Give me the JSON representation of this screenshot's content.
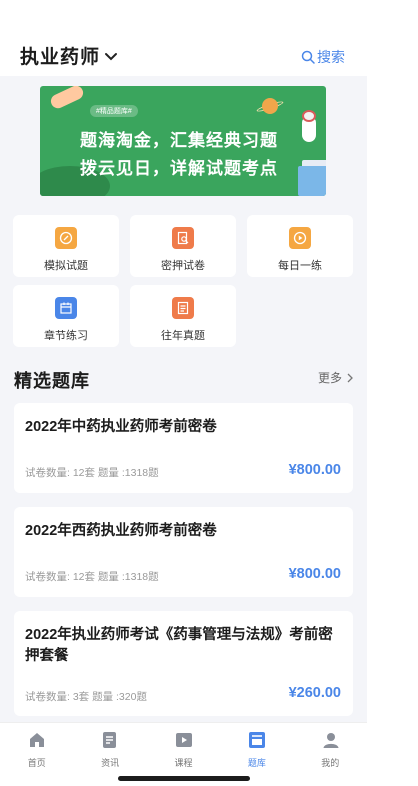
{
  "header": {
    "title": "执业药师",
    "search_label": "搜索"
  },
  "banner": {
    "tag": "#精品题库#",
    "line1": "题海淘金，汇集经典习题",
    "line2": "拨云见日，详解试题考点"
  },
  "features": [
    {
      "label": "模拟试题",
      "icon": "edit-circle-icon",
      "color": "#f5a742"
    },
    {
      "label": "密押试卷",
      "icon": "document-search-icon",
      "color": "#ef7b4a"
    },
    {
      "label": "每日一练",
      "icon": "play-circle-icon",
      "color": "#f5a742"
    },
    {
      "label": "章节练习",
      "icon": "calendar-icon",
      "color": "#4a86e8"
    },
    {
      "label": "往年真题",
      "icon": "list-doc-icon",
      "color": "#ef7b4a"
    }
  ],
  "section": {
    "title": "精选题库",
    "more_label": "更多"
  },
  "cards": [
    {
      "title": "2022年中药执业药师考前密卷",
      "meta": "试卷数量: 12套   题量 :1318题",
      "price": "¥800.00"
    },
    {
      "title": "2022年西药执业药师考前密卷",
      "meta": "试卷数量: 12套   题量 :1318题",
      "price": "¥800.00"
    },
    {
      "title": "2022年执业药师考试《药事管理与法规》考前密押套餐",
      "meta": "试卷数量: 3套   题量 :320题",
      "price": "¥260.00"
    }
  ],
  "tabbar": [
    {
      "label": "首页",
      "icon": "home-icon",
      "active": false
    },
    {
      "label": "资讯",
      "icon": "news-icon",
      "active": false
    },
    {
      "label": "课程",
      "icon": "video-icon",
      "active": false
    },
    {
      "label": "题库",
      "icon": "question-bank-icon",
      "active": true
    },
    {
      "label": "我的",
      "icon": "user-icon",
      "active": false
    }
  ],
  "colors": {
    "accent": "#4a86e8",
    "banner_green": "#3aa55d",
    "background": "#f4f5f9"
  }
}
